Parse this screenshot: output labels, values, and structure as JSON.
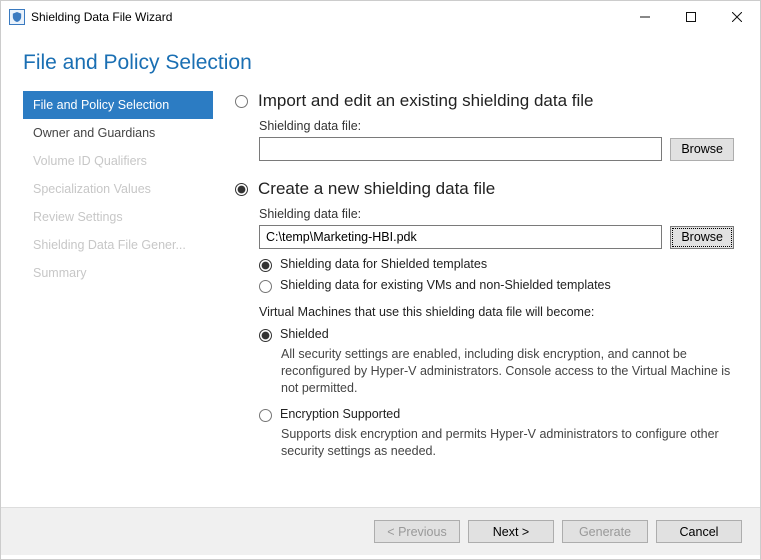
{
  "window": {
    "title": "Shielding Data File Wizard"
  },
  "header": {
    "title": "File and Policy Selection"
  },
  "sidebar": {
    "steps": [
      {
        "label": "File and Policy Selection"
      },
      {
        "label": "Owner and Guardians"
      },
      {
        "label": "Volume ID Qualifiers"
      },
      {
        "label": "Specialization Values"
      },
      {
        "label": "Review Settings"
      },
      {
        "label": "Shielding Data File Gener..."
      },
      {
        "label": "Summary"
      }
    ]
  },
  "options": {
    "import": {
      "title": "Import and edit an existing shielding data file",
      "file_label": "Shielding data file:",
      "file_value": "",
      "browse": "Browse"
    },
    "create": {
      "title": "Create a new shielding data file",
      "file_label": "Shielding data file:",
      "file_value": "C:\\temp\\Marketing-HBI.pdk",
      "browse": "Browse",
      "template_shielded": "Shielding data for Shielded templates",
      "template_existing": "Shielding data for existing VMs and non-Shielded templates",
      "vm_note": "Virtual Machines that use this shielding data file will become:",
      "policy_shielded": {
        "label": "Shielded",
        "desc": "All security settings are enabled, including disk encryption, and cannot be reconfigured by Hyper-V administrators. Console access to the Virtual Machine is not permitted."
      },
      "policy_encryption": {
        "label": "Encryption Supported",
        "desc": "Supports disk encryption and permits Hyper-V administrators to configure other security settings as needed."
      }
    }
  },
  "footer": {
    "previous": "< Previous",
    "next": "Next >",
    "generate": "Generate",
    "cancel": "Cancel"
  }
}
